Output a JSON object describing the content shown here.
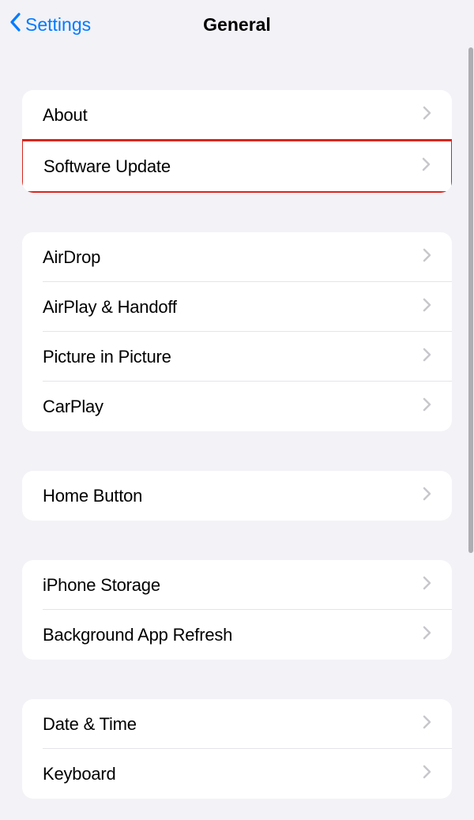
{
  "header": {
    "back_label": "Settings",
    "title": "General"
  },
  "groups": [
    {
      "items": [
        {
          "name": "about",
          "label": "About"
        },
        {
          "name": "software-update",
          "label": "Software Update",
          "highlighted": true
        }
      ]
    },
    {
      "items": [
        {
          "name": "airdrop",
          "label": "AirDrop"
        },
        {
          "name": "airplay-handoff",
          "label": "AirPlay & Handoff"
        },
        {
          "name": "picture-in-picture",
          "label": "Picture in Picture"
        },
        {
          "name": "carplay",
          "label": "CarPlay"
        }
      ]
    },
    {
      "items": [
        {
          "name": "home-button",
          "label": "Home Button"
        }
      ]
    },
    {
      "items": [
        {
          "name": "iphone-storage",
          "label": "iPhone Storage"
        },
        {
          "name": "background-app-refresh",
          "label": "Background App Refresh"
        }
      ]
    },
    {
      "items": [
        {
          "name": "date-time",
          "label": "Date & Time"
        },
        {
          "name": "keyboard",
          "label": "Keyboard"
        }
      ]
    }
  ]
}
